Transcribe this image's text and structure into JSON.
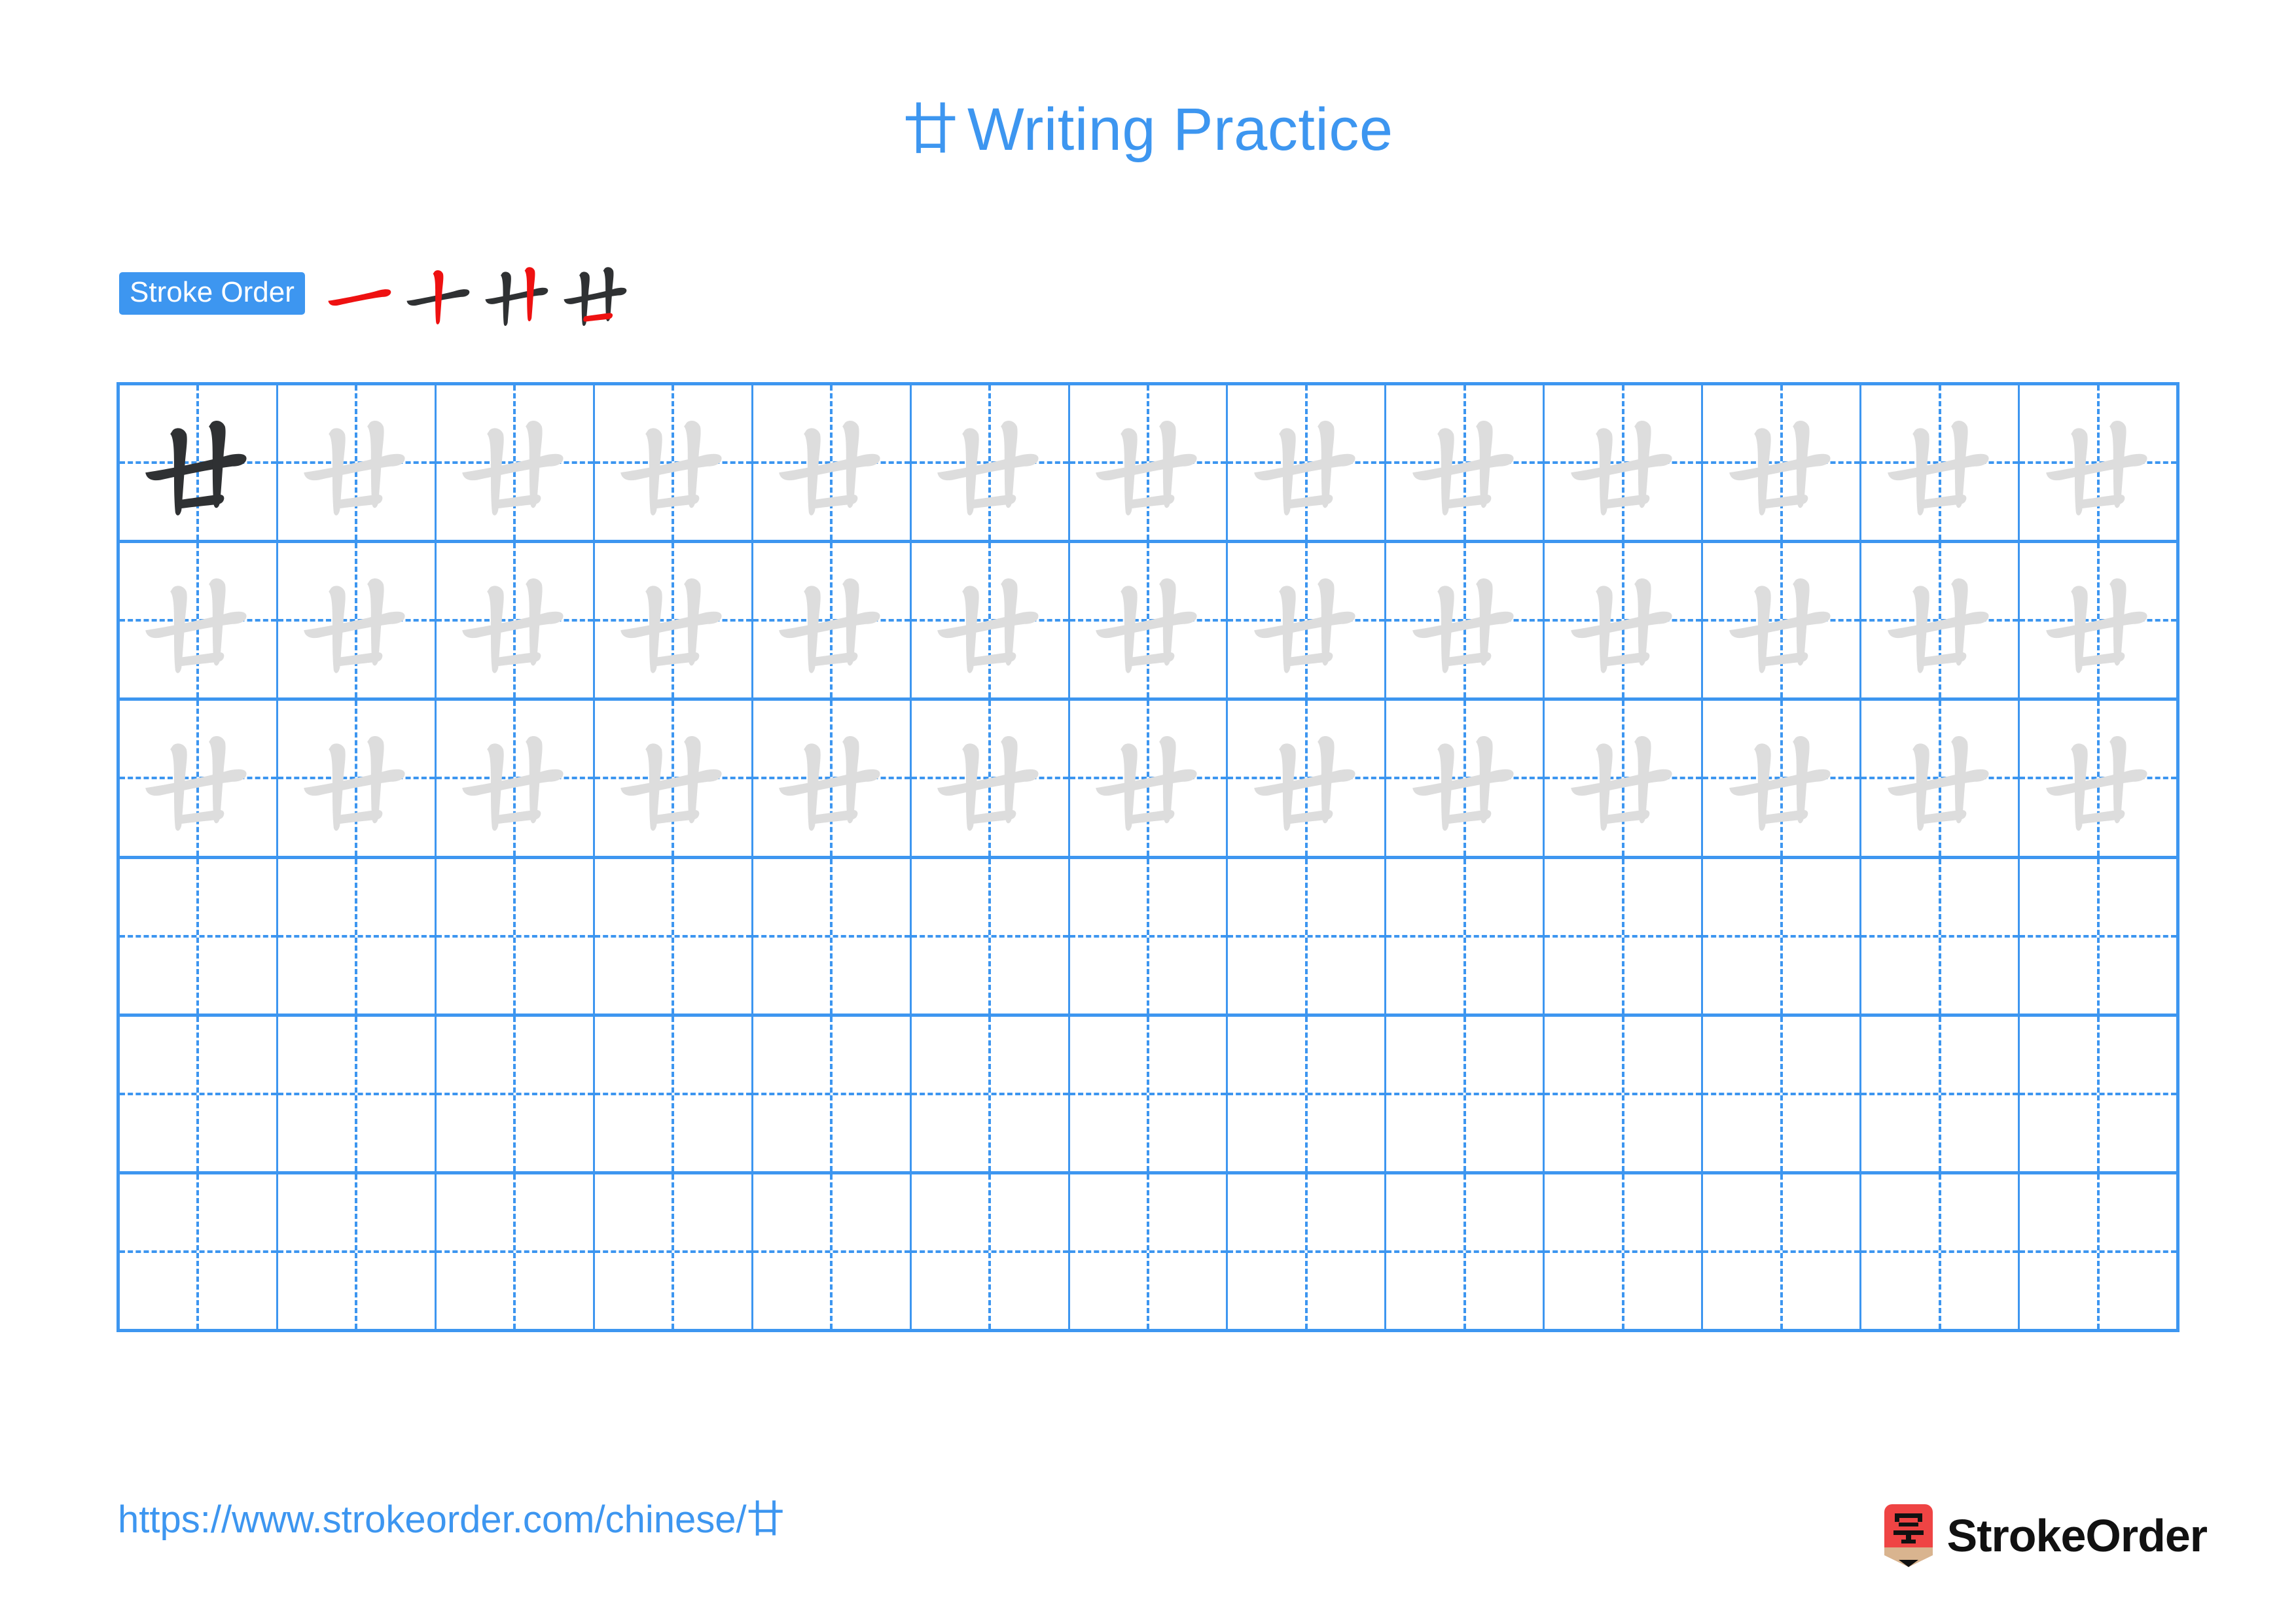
{
  "page": {
    "character": "廿",
    "background_color": "#ffffff",
    "accent_color": "#3d96f0",
    "trace_color": "#dddddd",
    "ink_color": "#2f3133",
    "highlight_color": "#ee1111"
  },
  "header": {
    "title_character": "廿",
    "title_text": "Writing Practice"
  },
  "stroke_order": {
    "badge_label": "Stroke Order",
    "steps": [
      {
        "index": 1,
        "new_stroke": "heng (horizontal)",
        "strokes_shown": 1
      },
      {
        "index": 2,
        "new_stroke": "shu (vertical left)",
        "strokes_shown": 2
      },
      {
        "index": 3,
        "new_stroke": "shu (vertical right)",
        "strokes_shown": 3
      },
      {
        "index": 4,
        "new_stroke": "heng (bottom horizontal)",
        "strokes_shown": 4
      }
    ],
    "total_strokes": 4
  },
  "practice_grid": {
    "columns": 13,
    "rows": 6,
    "guide_style": "dashed-cross",
    "rows_data": [
      {
        "row": 1,
        "cells": [
          "ink",
          "trace",
          "trace",
          "trace",
          "trace",
          "trace",
          "trace",
          "trace",
          "trace",
          "trace",
          "trace",
          "trace",
          "trace"
        ]
      },
      {
        "row": 2,
        "cells": [
          "trace",
          "trace",
          "trace",
          "trace",
          "trace",
          "trace",
          "trace",
          "trace",
          "trace",
          "trace",
          "trace",
          "trace",
          "trace"
        ]
      },
      {
        "row": 3,
        "cells": [
          "trace",
          "trace",
          "trace",
          "trace",
          "trace",
          "trace",
          "trace",
          "trace",
          "trace",
          "trace",
          "trace",
          "trace",
          "trace"
        ]
      },
      {
        "row": 4,
        "cells": [
          "empty",
          "empty",
          "empty",
          "empty",
          "empty",
          "empty",
          "empty",
          "empty",
          "empty",
          "empty",
          "empty",
          "empty",
          "empty"
        ]
      },
      {
        "row": 5,
        "cells": [
          "empty",
          "empty",
          "empty",
          "empty",
          "empty",
          "empty",
          "empty",
          "empty",
          "empty",
          "empty",
          "empty",
          "empty",
          "empty"
        ]
      },
      {
        "row": 6,
        "cells": [
          "empty",
          "empty",
          "empty",
          "empty",
          "empty",
          "empty",
          "empty",
          "empty",
          "empty",
          "empty",
          "empty",
          "empty",
          "empty"
        ]
      }
    ]
  },
  "footer": {
    "url": "https://www.strokeorder.com/chinese/廿",
    "brand_name": "StrokeOrder",
    "brand_mark_character": "字",
    "brand_mark_color": "#ef4444",
    "brand_mark_tip_color": "#d9b48f"
  }
}
